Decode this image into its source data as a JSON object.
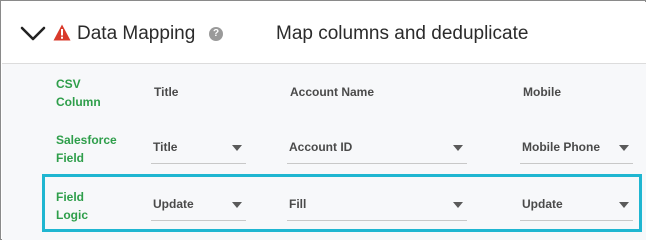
{
  "header": {
    "section_title": "Data Mapping",
    "help_symbol": "?",
    "subtitle": "Map columns and deduplicate"
  },
  "rows": {
    "csv_column_label": "CSV\nColumn",
    "salesforce_field_label": "Salesforce\nField",
    "field_logic_label": "Field\nLogic"
  },
  "columns": {
    "col1": "Title",
    "col2": "Account Name",
    "col3": "Mobile"
  },
  "salesforce_fields": {
    "col1": "Title",
    "col2": "Account ID",
    "col3": "Mobile Phone"
  },
  "field_logic": {
    "col1": "Update",
    "col2": "Fill",
    "col3": "Update"
  },
  "colors": {
    "label_green": "#2e9e4a",
    "highlight_cyan": "#1fb6d1",
    "warning_red": "#d93a2b"
  },
  "icons": {
    "collapse": "chevron-down-icon",
    "warning": "warning-triangle-icon",
    "help": "help-circle-icon"
  }
}
